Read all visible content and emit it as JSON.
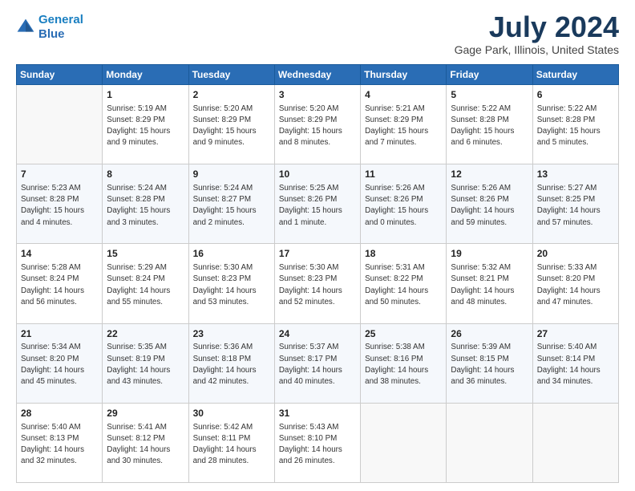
{
  "header": {
    "logo_line1": "General",
    "logo_line2": "Blue",
    "month": "July 2024",
    "location": "Gage Park, Illinois, United States"
  },
  "weekdays": [
    "Sunday",
    "Monday",
    "Tuesday",
    "Wednesday",
    "Thursday",
    "Friday",
    "Saturday"
  ],
  "weeks": [
    [
      {
        "day": "",
        "info": ""
      },
      {
        "day": "1",
        "info": "Sunrise: 5:19 AM\nSunset: 8:29 PM\nDaylight: 15 hours\nand 9 minutes."
      },
      {
        "day": "2",
        "info": "Sunrise: 5:20 AM\nSunset: 8:29 PM\nDaylight: 15 hours\nand 9 minutes."
      },
      {
        "day": "3",
        "info": "Sunrise: 5:20 AM\nSunset: 8:29 PM\nDaylight: 15 hours\nand 8 minutes."
      },
      {
        "day": "4",
        "info": "Sunrise: 5:21 AM\nSunset: 8:29 PM\nDaylight: 15 hours\nand 7 minutes."
      },
      {
        "day": "5",
        "info": "Sunrise: 5:22 AM\nSunset: 8:28 PM\nDaylight: 15 hours\nand 6 minutes."
      },
      {
        "day": "6",
        "info": "Sunrise: 5:22 AM\nSunset: 8:28 PM\nDaylight: 15 hours\nand 5 minutes."
      }
    ],
    [
      {
        "day": "7",
        "info": "Sunrise: 5:23 AM\nSunset: 8:28 PM\nDaylight: 15 hours\nand 4 minutes."
      },
      {
        "day": "8",
        "info": "Sunrise: 5:24 AM\nSunset: 8:28 PM\nDaylight: 15 hours\nand 3 minutes."
      },
      {
        "day": "9",
        "info": "Sunrise: 5:24 AM\nSunset: 8:27 PM\nDaylight: 15 hours\nand 2 minutes."
      },
      {
        "day": "10",
        "info": "Sunrise: 5:25 AM\nSunset: 8:26 PM\nDaylight: 15 hours\nand 1 minute."
      },
      {
        "day": "11",
        "info": "Sunrise: 5:26 AM\nSunset: 8:26 PM\nDaylight: 15 hours\nand 0 minutes."
      },
      {
        "day": "12",
        "info": "Sunrise: 5:26 AM\nSunset: 8:26 PM\nDaylight: 14 hours\nand 59 minutes."
      },
      {
        "day": "13",
        "info": "Sunrise: 5:27 AM\nSunset: 8:25 PM\nDaylight: 14 hours\nand 57 minutes."
      }
    ],
    [
      {
        "day": "14",
        "info": "Sunrise: 5:28 AM\nSunset: 8:24 PM\nDaylight: 14 hours\nand 56 minutes."
      },
      {
        "day": "15",
        "info": "Sunrise: 5:29 AM\nSunset: 8:24 PM\nDaylight: 14 hours\nand 55 minutes."
      },
      {
        "day": "16",
        "info": "Sunrise: 5:30 AM\nSunset: 8:23 PM\nDaylight: 14 hours\nand 53 minutes."
      },
      {
        "day": "17",
        "info": "Sunrise: 5:30 AM\nSunset: 8:23 PM\nDaylight: 14 hours\nand 52 minutes."
      },
      {
        "day": "18",
        "info": "Sunrise: 5:31 AM\nSunset: 8:22 PM\nDaylight: 14 hours\nand 50 minutes."
      },
      {
        "day": "19",
        "info": "Sunrise: 5:32 AM\nSunset: 8:21 PM\nDaylight: 14 hours\nand 48 minutes."
      },
      {
        "day": "20",
        "info": "Sunrise: 5:33 AM\nSunset: 8:20 PM\nDaylight: 14 hours\nand 47 minutes."
      }
    ],
    [
      {
        "day": "21",
        "info": "Sunrise: 5:34 AM\nSunset: 8:20 PM\nDaylight: 14 hours\nand 45 minutes."
      },
      {
        "day": "22",
        "info": "Sunrise: 5:35 AM\nSunset: 8:19 PM\nDaylight: 14 hours\nand 43 minutes."
      },
      {
        "day": "23",
        "info": "Sunrise: 5:36 AM\nSunset: 8:18 PM\nDaylight: 14 hours\nand 42 minutes."
      },
      {
        "day": "24",
        "info": "Sunrise: 5:37 AM\nSunset: 8:17 PM\nDaylight: 14 hours\nand 40 minutes."
      },
      {
        "day": "25",
        "info": "Sunrise: 5:38 AM\nSunset: 8:16 PM\nDaylight: 14 hours\nand 38 minutes."
      },
      {
        "day": "26",
        "info": "Sunrise: 5:39 AM\nSunset: 8:15 PM\nDaylight: 14 hours\nand 36 minutes."
      },
      {
        "day": "27",
        "info": "Sunrise: 5:40 AM\nSunset: 8:14 PM\nDaylight: 14 hours\nand 34 minutes."
      }
    ],
    [
      {
        "day": "28",
        "info": "Sunrise: 5:40 AM\nSunset: 8:13 PM\nDaylight: 14 hours\nand 32 minutes."
      },
      {
        "day": "29",
        "info": "Sunrise: 5:41 AM\nSunset: 8:12 PM\nDaylight: 14 hours\nand 30 minutes."
      },
      {
        "day": "30",
        "info": "Sunrise: 5:42 AM\nSunset: 8:11 PM\nDaylight: 14 hours\nand 28 minutes."
      },
      {
        "day": "31",
        "info": "Sunrise: 5:43 AM\nSunset: 8:10 PM\nDaylight: 14 hours\nand 26 minutes."
      },
      {
        "day": "",
        "info": ""
      },
      {
        "day": "",
        "info": ""
      },
      {
        "day": "",
        "info": ""
      }
    ]
  ]
}
